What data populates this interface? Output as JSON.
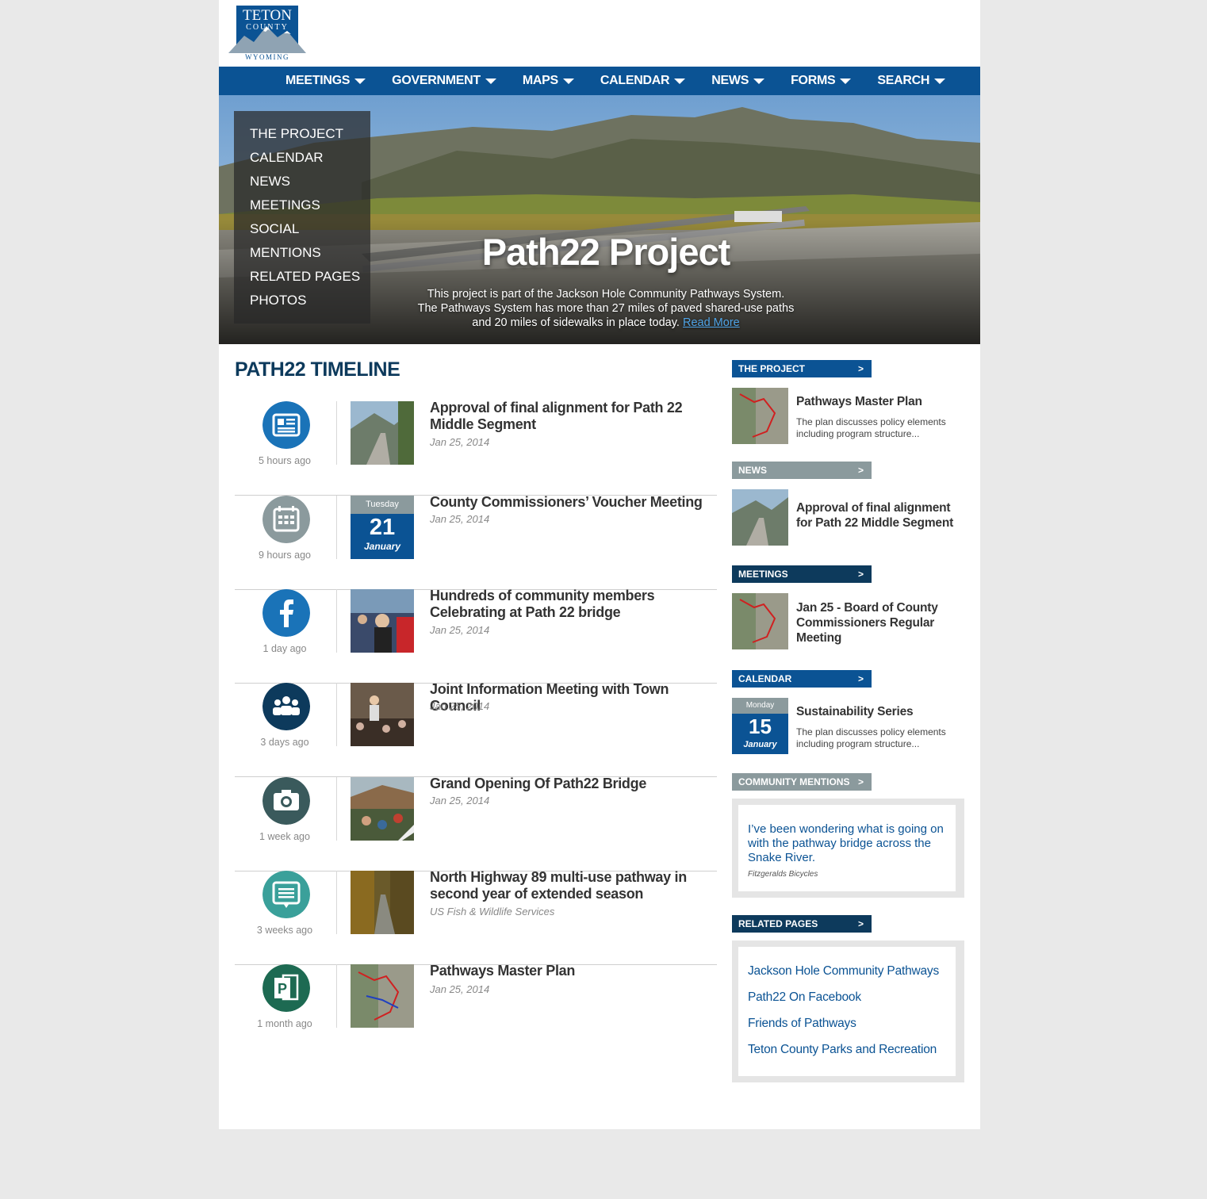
{
  "logo": {
    "line1": "TETON",
    "line2": "COUNTY",
    "line3": "WYOMING"
  },
  "nav": [
    "MEETINGS",
    "GOVERNMENT",
    "MAPS",
    "CALENDAR",
    "NEWS",
    "FORMS",
    "SEARCH"
  ],
  "hero": {
    "menu": [
      "THE PROJECT",
      "CALENDAR",
      "NEWS",
      "MEETINGS",
      "SOCIAL",
      "MENTIONS",
      "RELATED PAGES",
      "PHOTOS"
    ],
    "title": "Path22 Project",
    "text": "This project is part of the Jackson Hole Community Pathways System. The Pathways System has more than 27 miles of paved shared-use paths and 20 miles of sidewalks in place today.",
    "read_more": "Read More"
  },
  "timeline": {
    "title": "PATH22 TIMELINE",
    "items": [
      {
        "icon": "newspaper-icon",
        "color": "#1a73b8",
        "ago": "5 hours ago",
        "title": "Approval of final alignment for Path 22 Middle Segment",
        "date": "Jan 25, 2014"
      },
      {
        "icon": "calendar-icon",
        "color": "#8b9a9d",
        "ago": "9 hours ago",
        "title": "County Commissioners’ Voucher Meeting",
        "date": "Jan 25, 2014",
        "cal": {
          "dow": "Tuesday",
          "day": "21",
          "mon": "January"
        }
      },
      {
        "icon": "facebook-icon",
        "color": "#1a73b8",
        "ago": "1 day ago",
        "title": "Hundreds of community members Celebrating at Path 22 bridge",
        "date": "Jan 25, 2014"
      },
      {
        "icon": "people-icon",
        "color": "#0d3a5c",
        "ago": "3 days ago",
        "title": "Joint Information Meeting with Town Council",
        "date": "Jan 25, 2014"
      },
      {
        "icon": "camera-icon",
        "color": "#3a5a5c",
        "ago": "1 week ago",
        "title": "Grand Opening Of Path22 Bridge",
        "date": "Jan 25, 2014"
      },
      {
        "icon": "comment-icon",
        "color": "#3aa09a",
        "ago": "3 weeks ago",
        "title": "North Highway 89 multi-use pathway in second year of extended season",
        "date": "US Fish & Wildlife Services"
      },
      {
        "icon": "publisher-icon",
        "color": "#1d6a52",
        "ago": "1 month ago",
        "title": "Pathways Master Plan",
        "date": "Jan 25, 2014"
      }
    ]
  },
  "sidebar": {
    "project": {
      "label": "THE PROJECT",
      "title": "Pathways Master Plan",
      "desc": "The plan discusses policy elements including program structure..."
    },
    "news": {
      "label": "NEWS",
      "title": "Approval of final alignment for Path 22 Middle Segment"
    },
    "meetings": {
      "label": "MEETINGS",
      "title": "Jan 25 - Board of County Commissioners Regular Meeting"
    },
    "calendar": {
      "label": "CALENDAR",
      "title": "Sustainability Series",
      "desc": "The plan discusses policy elements including program structure...",
      "cal": {
        "dow": "Monday",
        "day": "15",
        "mon": "January"
      }
    },
    "mentions": {
      "label": "COMMUNITY MENTIONS",
      "quote": "I’ve been wondering what is going on with the pathway bridge across the Snake River.",
      "source": "Fitzgeralds Bicycles"
    },
    "related": {
      "label": "RELATED PAGES",
      "links": [
        "Jackson Hole Community Pathways",
        "Path22 On Facebook",
        "Friends of Pathways",
        "Teton County Parks and Recreation"
      ]
    },
    "arrow": ">"
  },
  "colors": {
    "primary": "#0b5394",
    "dark": "#0d3a5c",
    "gray": "#8b9a9d"
  }
}
